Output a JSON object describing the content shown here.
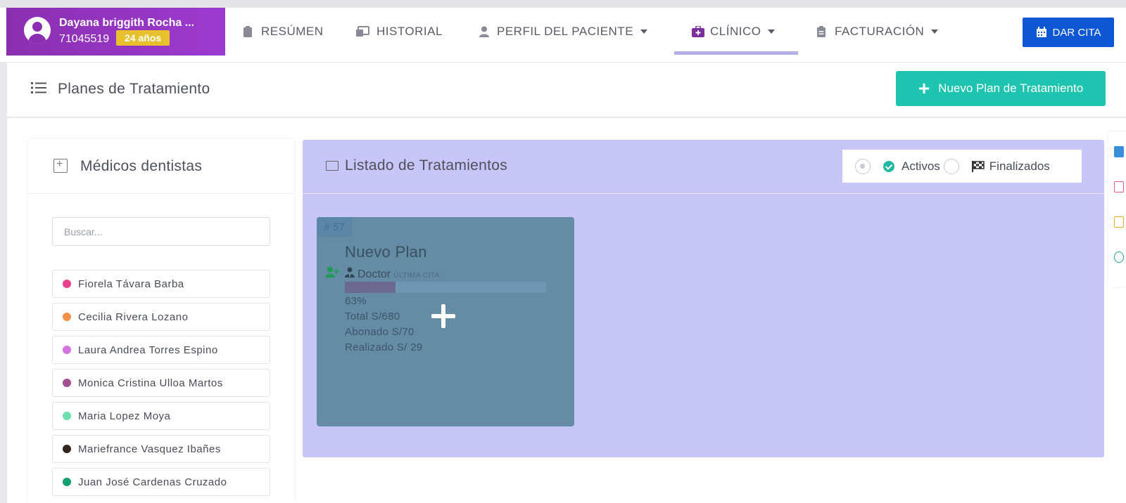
{
  "patient": {
    "name": "Dayana briggith Rocha ...",
    "dni": "71045519",
    "age": "24 años"
  },
  "nav": [
    {
      "label": "RESÚMEN"
    },
    {
      "label": "HISTORIAL"
    },
    {
      "label": "PERFIL DEL PACIENTE"
    },
    {
      "label": "CLÍNICO"
    },
    {
      "label": "FACTURACIÓN"
    }
  ],
  "actions": {
    "dar_cita": "DAR CITA",
    "new_plan": "Nuevo Plan de Tratamiento"
  },
  "page": {
    "title": "Planes de Tratamiento"
  },
  "doctors": {
    "title": "Médicos dentistas",
    "search_placeholder": "Buscar...",
    "items": [
      {
        "name": "Fiorela Távara Barba",
        "color": "#ea3f8c"
      },
      {
        "name": "Cecilia Rivera Lozano",
        "color": "#f58f4a"
      },
      {
        "name": "Laura Andrea Torres Espino",
        "color": "#d574e0"
      },
      {
        "name": "Monica Cristina Ulloa Martos",
        "color": "#a2508f"
      },
      {
        "name": "Maria Lopez Moya",
        "color": "#6ee0b0"
      },
      {
        "name": "Mariefrance Vasquez Ibañes",
        "color": "#33241e"
      },
      {
        "name": "Juan José Cardenas Cruzado",
        "color": "#16a070"
      }
    ]
  },
  "treatments": {
    "title": "Listado de Tratamientos",
    "filter_active": "Activos",
    "filter_finished": "Finalizados",
    "plans": [
      {
        "number": "# 57",
        "name": "Nuevo Plan",
        "doctor": "Doctor",
        "last_visit_label": "ÚLTIMA CITA :",
        "progress_pct": 25,
        "progress_label": "63%",
        "total": "Total S/680",
        "paid": "Abonado S/70",
        "done": "Realizado S/ 29"
      }
    ]
  }
}
